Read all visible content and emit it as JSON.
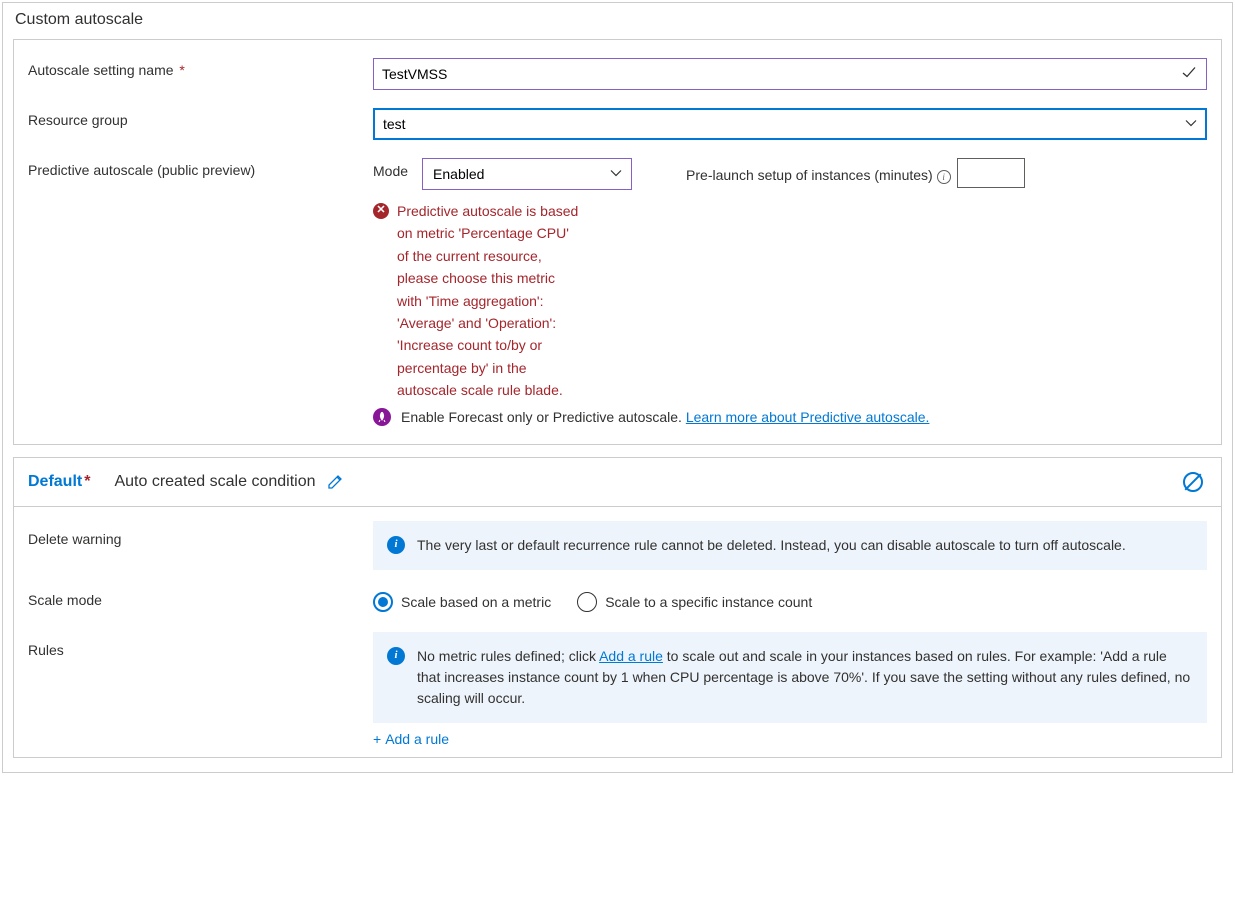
{
  "panelTitle": "Custom autoscale",
  "settingNameLabel": "Autoscale setting name",
  "settingNameValue": "TestVMSS",
  "resGroupLabel": "Resource group",
  "resGroupValue": "test",
  "predictiveLabel": "Predictive autoscale (public preview)",
  "modeLabel": "Mode",
  "modeValue": "Enabled",
  "prelaunchLabel": "Pre-launch setup of instances (minutes)",
  "errorText": "Predictive autoscale is based on metric 'Percentage CPU' of the current resource, please choose this metric with 'Time aggregation': 'Average' and 'Operation': 'Increase count to/by or percentage by' in the autoscale scale rule blade.",
  "forecastText": "Enable Forecast only or Predictive autoscale.",
  "forecastLink": "Learn more about Predictive autoscale.",
  "condition": {
    "title": "Default",
    "subtitle": "Auto created scale condition",
    "deleteWarnLabel": "Delete warning",
    "deleteWarnText": "The very last or default recurrence rule cannot be deleted. Instead, you can disable autoscale to turn off autoscale.",
    "scaleModeLabel": "Scale mode",
    "scaleModeOpt1": "Scale based on a metric",
    "scaleModeOpt2": "Scale to a specific instance count",
    "rulesLabel": "Rules",
    "rulesInfoPrefix": "No metric rules defined; click ",
    "rulesInfoLink": "Add a rule",
    "rulesInfoSuffix": " to scale out and scale in your instances based on rules. For example: 'Add a rule that increases instance count by 1 when CPU percentage is above 70%'. If you save the setting without any rules defined, no scaling will occur.",
    "addRuleText": "Add a rule"
  }
}
